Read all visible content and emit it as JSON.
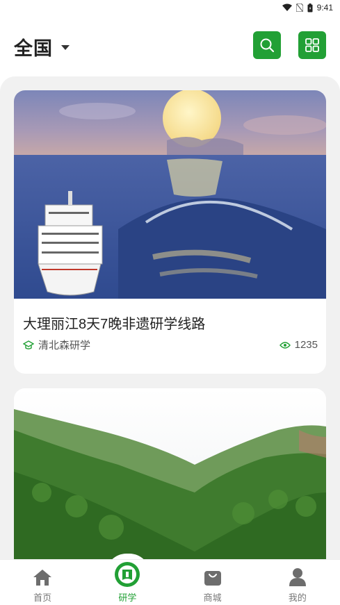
{
  "status_bar": {
    "time": "9:41"
  },
  "header": {
    "region": "全国",
    "search_icon": "search-icon",
    "grid_icon": "grid-icon"
  },
  "cards": [
    {
      "title": "大理丽江8天7晚非遗研学线路",
      "org": "清北森研学",
      "views": "1235"
    },
    {
      "title": "",
      "org": "",
      "views": ""
    }
  ],
  "tabs": [
    {
      "label": "首页",
      "icon": "home-icon"
    },
    {
      "label": "研学",
      "icon": "study-icon"
    },
    {
      "label": "商城",
      "icon": "shop-icon"
    },
    {
      "label": "我的",
      "icon": "profile-icon"
    }
  ],
  "colors": {
    "accent": "#22a035",
    "inactive": "#777777"
  }
}
